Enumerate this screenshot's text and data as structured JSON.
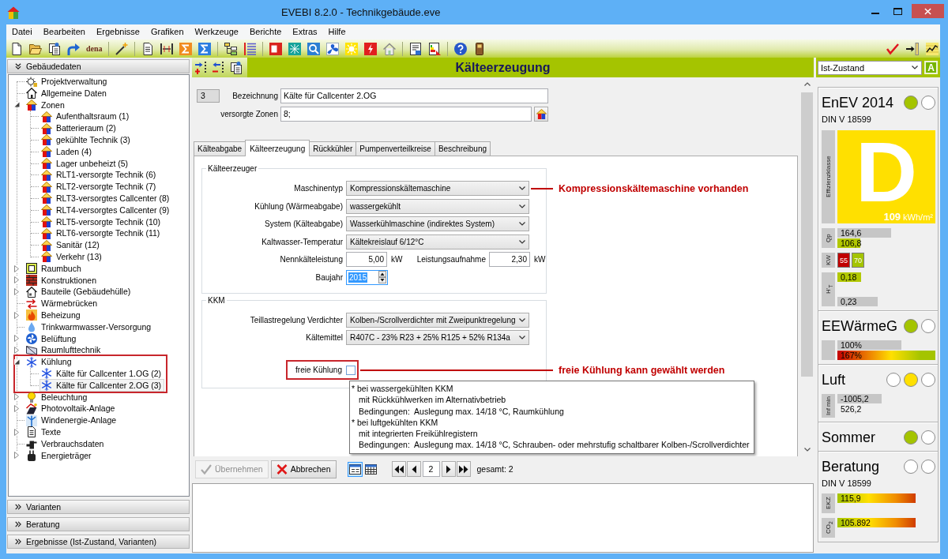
{
  "window": {
    "title": "EVEBI 8.2.0 - Technikgebäude.eve"
  },
  "menu": [
    "Datei",
    "Bearbeiten",
    "Ergebnisse",
    "Grafiken",
    "Werkzeuge",
    "Berichte",
    "Extras",
    "Hilfe"
  ],
  "toolbar": {
    "logo_text": "dena"
  },
  "sidebar": {
    "header": {
      "label": "Gebäudedaten",
      "expanded": true
    },
    "tree": [
      {
        "label": "Projektverwaltung",
        "kind": "project",
        "expandable": false,
        "expanded": false,
        "selected": false,
        "marked": false
      },
      {
        "label": "Allgemeine Daten",
        "kind": "general",
        "expandable": false,
        "expanded": false,
        "selected": false,
        "marked": false
      },
      {
        "label": "Zonen",
        "kind": "zones",
        "expandable": true,
        "expanded": true,
        "selected": false,
        "marked": false,
        "children": [
          {
            "label": "Aufenthaltsraum (1)",
            "kind": "zone",
            "selected": false
          },
          {
            "label": "Batterieraum (2)",
            "kind": "zone",
            "selected": false
          },
          {
            "label": "gekühlte Technik (3)",
            "kind": "zone",
            "selected": false
          },
          {
            "label": "Laden (4)",
            "kind": "zone",
            "selected": false
          },
          {
            "label": "Lager unbeheizt (5)",
            "kind": "zone",
            "selected": false
          },
          {
            "label": "RLT1-versorgte Technik (6)",
            "kind": "zone",
            "selected": false
          },
          {
            "label": "RLT2-versorgte Technik (7)",
            "kind": "zone",
            "selected": false
          },
          {
            "label": "RLT3-versorgtes Callcenter (8)",
            "kind": "zone",
            "selected": false
          },
          {
            "label": "RLT4-versorgtes Callcenter (9)",
            "kind": "zone",
            "selected": false
          },
          {
            "label": "RLT5-versorgte Technik (10)",
            "kind": "zone",
            "selected": false
          },
          {
            "label": "RLT6-versorgte Technik (11)",
            "kind": "zone",
            "selected": false
          },
          {
            "label": "Sanitär (12)",
            "kind": "zone",
            "selected": false
          },
          {
            "label": "Verkehr (13)",
            "kind": "zone",
            "selected": false
          }
        ]
      },
      {
        "label": "Raumbuch",
        "kind": "roombook",
        "expandable": true,
        "expanded": false,
        "selected": false,
        "marked": false
      },
      {
        "label": "Konstruktionen",
        "kind": "constructions",
        "expandable": true,
        "expanded": false,
        "selected": false,
        "marked": false
      },
      {
        "label": "Bauteile (Gebäudehülle)",
        "kind": "components",
        "expandable": true,
        "expanded": false,
        "selected": false,
        "marked": false
      },
      {
        "label": "Wärmebrücken",
        "kind": "bridges",
        "expandable": false,
        "expanded": false,
        "selected": false,
        "marked": false
      },
      {
        "label": "Beheizung",
        "kind": "heating",
        "expandable": true,
        "expanded": false,
        "selected": false,
        "marked": false
      },
      {
        "label": "Trinkwarmwasser-Versorgung",
        "kind": "water",
        "expandable": false,
        "expanded": false,
        "selected": false,
        "marked": false
      },
      {
        "label": "Belüftung",
        "kind": "ventilation",
        "expandable": true,
        "expanded": false,
        "selected": false,
        "marked": false
      },
      {
        "label": "Raumlufttechnik",
        "kind": "airtech",
        "expandable": true,
        "expanded": false,
        "selected": false,
        "marked": false
      },
      {
        "label": "Kühlung",
        "kind": "cooling",
        "expandable": true,
        "expanded": true,
        "selected": false,
        "marked": true,
        "children": [
          {
            "label": "Kälte für Callcenter 1.OG (2)",
            "kind": "cooling",
            "selected": false
          },
          {
            "label": "Kälte für Callcenter 2.OG (3)",
            "kind": "cooling",
            "selected": true
          }
        ]
      },
      {
        "label": "Beleuchtung",
        "kind": "lighting",
        "expandable": true,
        "expanded": false,
        "selected": false,
        "marked": false
      },
      {
        "label": "Photovoltaik-Anlage",
        "kind": "photovoltaic",
        "expandable": true,
        "expanded": false,
        "selected": false,
        "marked": false
      },
      {
        "label": "Windenergie-Anlage",
        "kind": "wind",
        "expandable": false,
        "expanded": false,
        "selected": false,
        "marked": false
      },
      {
        "label": "Texte",
        "kind": "texts",
        "expandable": true,
        "expanded": false,
        "selected": false,
        "marked": false
      },
      {
        "label": "Verbrauchsdaten",
        "kind": "consumption",
        "expandable": false,
        "expanded": false,
        "selected": false,
        "marked": false
      },
      {
        "label": "Energieträger",
        "kind": "carriers",
        "expandable": true,
        "expanded": false,
        "selected": false,
        "marked": false
      }
    ],
    "sections": [
      {
        "label": "Varianten",
        "expanded": false
      },
      {
        "label": "Beratung",
        "expanded": false
      },
      {
        "label": "Ergebnisse (Ist-Zustand, Varianten)",
        "expanded": false
      }
    ]
  },
  "editor": {
    "title": "Kälteerzeugung",
    "record_number": "3",
    "fields": [
      {
        "kind": "text",
        "label": "Bezeichnung",
        "value": "Kälte für Callcenter 2.OG"
      },
      {
        "kind": "zones",
        "label": "versorgte Zonen",
        "value": "8;"
      }
    ],
    "tabs": [
      {
        "label": "Kälteabgabe",
        "selected": false
      },
      {
        "label": "Kälteerzeugung",
        "selected": true
      },
      {
        "label": "Rückkühler",
        "selected": false
      },
      {
        "label": "Pumpenverteilkreise",
        "selected": false
      },
      {
        "label": "Beschreibung",
        "selected": false
      }
    ],
    "groups": [
      {
        "title": "Kälteerzeuger",
        "rows": [
          {
            "kind": "select",
            "label": "Maschinentyp",
            "value": "Kompressionskältemaschine",
            "marked": false,
            "callout": "Kompressionskältemaschine vorhanden"
          },
          {
            "kind": "select",
            "label": "Kühlung (Wärmeabgabe)",
            "value": "wassergekühlt",
            "marked": false
          },
          {
            "kind": "select",
            "label": "System (Kälteabgabe)",
            "value": "Wasserkühlmaschine (indirektes System)",
            "marked": false
          },
          {
            "kind": "select",
            "label": "Kaltwasser-Temperatur",
            "value": "Kältekreislauf 6/12°C",
            "marked": false
          },
          {
            "kind": "numbers",
            "marked": false,
            "items": [
              {
                "label": "Nennkälteleistung",
                "value": "5,00",
                "unit": "kW"
              },
              {
                "label": "Leistungsaufnahme",
                "value": "2,30",
                "unit": "kW"
              }
            ]
          },
          {
            "kind": "spinner",
            "label": "Baujahr",
            "value": "2015",
            "focused": true,
            "marked": false
          }
        ]
      },
      {
        "title": "KKM",
        "rows": [
          {
            "kind": "select",
            "label": "Teillastregelung Verdichter",
            "value": "Kolben-/Scrollverdichter mit Zweipunktregelung",
            "marked": false
          },
          {
            "kind": "select",
            "label": "Kältemittel",
            "value": "R407C - 23% R23 + 25% R125 + 52% R134a",
            "marked": false
          },
          {
            "kind": "checkbox",
            "label": "freie Kühlung",
            "checked": false,
            "marked": true,
            "callout": "freie Kühlung kann gewählt werden"
          }
        ]
      }
    ],
    "tooltip": {
      "lines": [
        {
          "kind": "bullet",
          "text": "* bei wassergekühlten KKM"
        },
        {
          "kind": "detail",
          "text": "mit Rückkühlwerken im Alternativbetrieb"
        },
        {
          "kind": "detail",
          "text": "Bedingungen:  Auslegung max. 14/18 °C, Raumkühlung"
        },
        {
          "kind": "bullet",
          "text": "* bei luftgekühlten KKM"
        },
        {
          "kind": "detail",
          "text": "mit integrierten Freikühlregistern"
        },
        {
          "kind": "detail",
          "text": "Bedingungen:  Auslegung max. 14/18 °C, Schrauben- oder mehrstufig schaltbarer Kolben-/Scrollverdichter"
        }
      ]
    },
    "actions": [
      {
        "kind": "apply",
        "label": "Übernehmen",
        "disabled": true
      },
      {
        "kind": "cancel",
        "label": "Abbrechen",
        "disabled": false
      }
    ],
    "views": [
      {
        "kind": "form",
        "selected": true
      },
      {
        "kind": "table",
        "selected": false
      }
    ],
    "pager": {
      "page": "2",
      "total": "gesamt: 2"
    }
  },
  "summary": {
    "variant": "Ist-Zustand",
    "badge": "A",
    "sections": [
      {
        "title": "EnEV 2014",
        "subtitle": "DIN V 18599",
        "lights": [
          {
            "color": "#a4c400"
          },
          {
            "color": "#ffffff"
          }
        ],
        "rating": {
          "label": "Effizienzklasse",
          "letter": "D",
          "value": "109",
          "unit": "kWh/m²",
          "color": "#ffe000"
        },
        "metrics": [
          {
            "label": "Qp",
            "kind": "bars",
            "bars": [
              {
                "text": "164,6",
                "kind": "reference",
                "level": 0.55
              },
              {
                "text": "106,8",
                "kind": "actual",
                "level": 0.23
              }
            ]
          },
          {
            "label": "KW",
            "kind": "tiles",
            "tiles": [
              {
                "text": "55",
                "color": "#c00000"
              },
              {
                "text": "70",
                "color": "#a4c400"
              }
            ]
          },
          {
            "label": "H'$_{T}$",
            "kind": "split",
            "bars": [
              {
                "text": "0,18",
                "kind": "actual",
                "level": 0.24
              },
              {
                "text": "0,23",
                "kind": "reference",
                "level": 0.41
              }
            ]
          }
        ]
      },
      {
        "title": "EEWärmeG",
        "lights": [
          {
            "color": "#a4c400"
          },
          {
            "color": "#ffffff"
          }
        ],
        "metrics": [
          {
            "kind": "bars",
            "bars": [
              {
                "text": "100%",
                "kind": "reference",
                "level": 0.65
              },
              {
                "text": "167%",
                "kind": "scale_up",
                "level": 1
              }
            ]
          }
        ]
      },
      {
        "title": "Luft",
        "lights": [
          {
            "color": "#ffffff"
          },
          {
            "color": "#ffe000"
          },
          {
            "color": "#ffffff"
          }
        ],
        "metrics": [
          {
            "label": "Inf min",
            "kind": "bars",
            "bars": [
              {
                "text": "-1005,2",
                "kind": "reference",
                "level": 0.45
              },
              {
                "text": "526,2",
                "kind": "plain"
              }
            ]
          }
        ]
      },
      {
        "title": "Sommer",
        "lights": [
          {
            "color": "#a4c400"
          },
          {
            "color": "#ffffff"
          }
        ]
      },
      {
        "title": "Beratung",
        "subtitle": "DIN V 18599",
        "lights": [
          {
            "color": "#ffffff"
          },
          {
            "color": "#ffffff"
          }
        ],
        "metrics": [
          {
            "label": "EKZ",
            "kind": "bars",
            "bars": [
              {
                "text": "115,9",
                "kind": "scale_down",
                "level": 0.8
              }
            ]
          },
          {
            "label": "CO$_{2}$",
            "kind": "bars",
            "bars": [
              {
                "text": "105.892",
                "kind": "scale_down",
                "level": 0.8
              }
            ]
          }
        ]
      }
    ]
  }
}
